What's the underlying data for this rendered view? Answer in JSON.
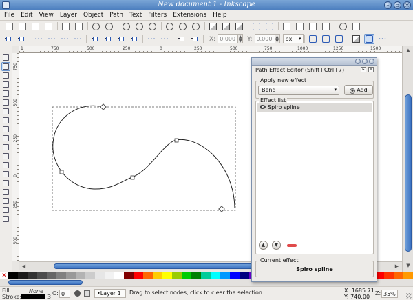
{
  "window": {
    "title": "New document 1 - Inkscape"
  },
  "menubar": {
    "items": [
      "File",
      "Edit",
      "View",
      "Layer",
      "Object",
      "Path",
      "Text",
      "Filters",
      "Extensions",
      "Help"
    ]
  },
  "controls": {
    "x_label": "X:",
    "x_value": "0.000",
    "y_label": "Y:",
    "y_value": "0.000",
    "unit": "px"
  },
  "ruler": {
    "h_ticks": [
      "1",
      "750",
      "500",
      "250",
      "0",
      "250",
      "500",
      "750",
      "1000",
      "1250",
      "1500"
    ],
    "v_ticks": [
      "750",
      "500",
      "250",
      "0",
      "250",
      "500"
    ]
  },
  "dialog": {
    "title": "Path Effect Editor (Shift+Ctrl+7)",
    "apply_label": "Apply new effect",
    "selected_effect": "Bend",
    "add_label": "Add",
    "list_label": "Effect list",
    "effects": [
      "Spiro spline"
    ],
    "current_label": "Current effect",
    "current_effect": "Spiro spline"
  },
  "palette": {
    "colors": [
      "#000000",
      "#1a1a1a",
      "#333333",
      "#4d4d4d",
      "#666666",
      "#808080",
      "#999999",
      "#b3b3b3",
      "#cccccc",
      "#e6e6e6",
      "#f2f2f2",
      "#ffffff",
      "#800000",
      "#ff0000",
      "#ff6600",
      "#ffcc00",
      "#ffff00",
      "#99cc00",
      "#00cc00",
      "#008000",
      "#00cc99",
      "#00ffff",
      "#0099ff",
      "#0000ff",
      "#000080",
      "#6600cc",
      "#9900ff",
      "#ff00ff",
      "#cc0066",
      "#ff6699",
      "#ff9966",
      "#ffcc99",
      "#ffff99",
      "#ccff99",
      "#99ffcc",
      "#99ccff",
      "#cc99ff",
      "#ff99cc",
      "#ff0000",
      "#ff3300",
      "#ff6600",
      "#ff9900"
    ]
  },
  "status": {
    "fill_label": "Fill:",
    "fill_value": "None",
    "stroke_label": "Stroke:",
    "stroke_width": "3",
    "opacity_label": "O:",
    "opacity_value": "0",
    "layer": "•Layer 1",
    "message": "Drag to select nodes, click to clear the selection",
    "x_coord": "X: 1685.71",
    "y_coord": "Y:   740.00",
    "zoom_label": "Z:",
    "zoom_value": "35%"
  }
}
